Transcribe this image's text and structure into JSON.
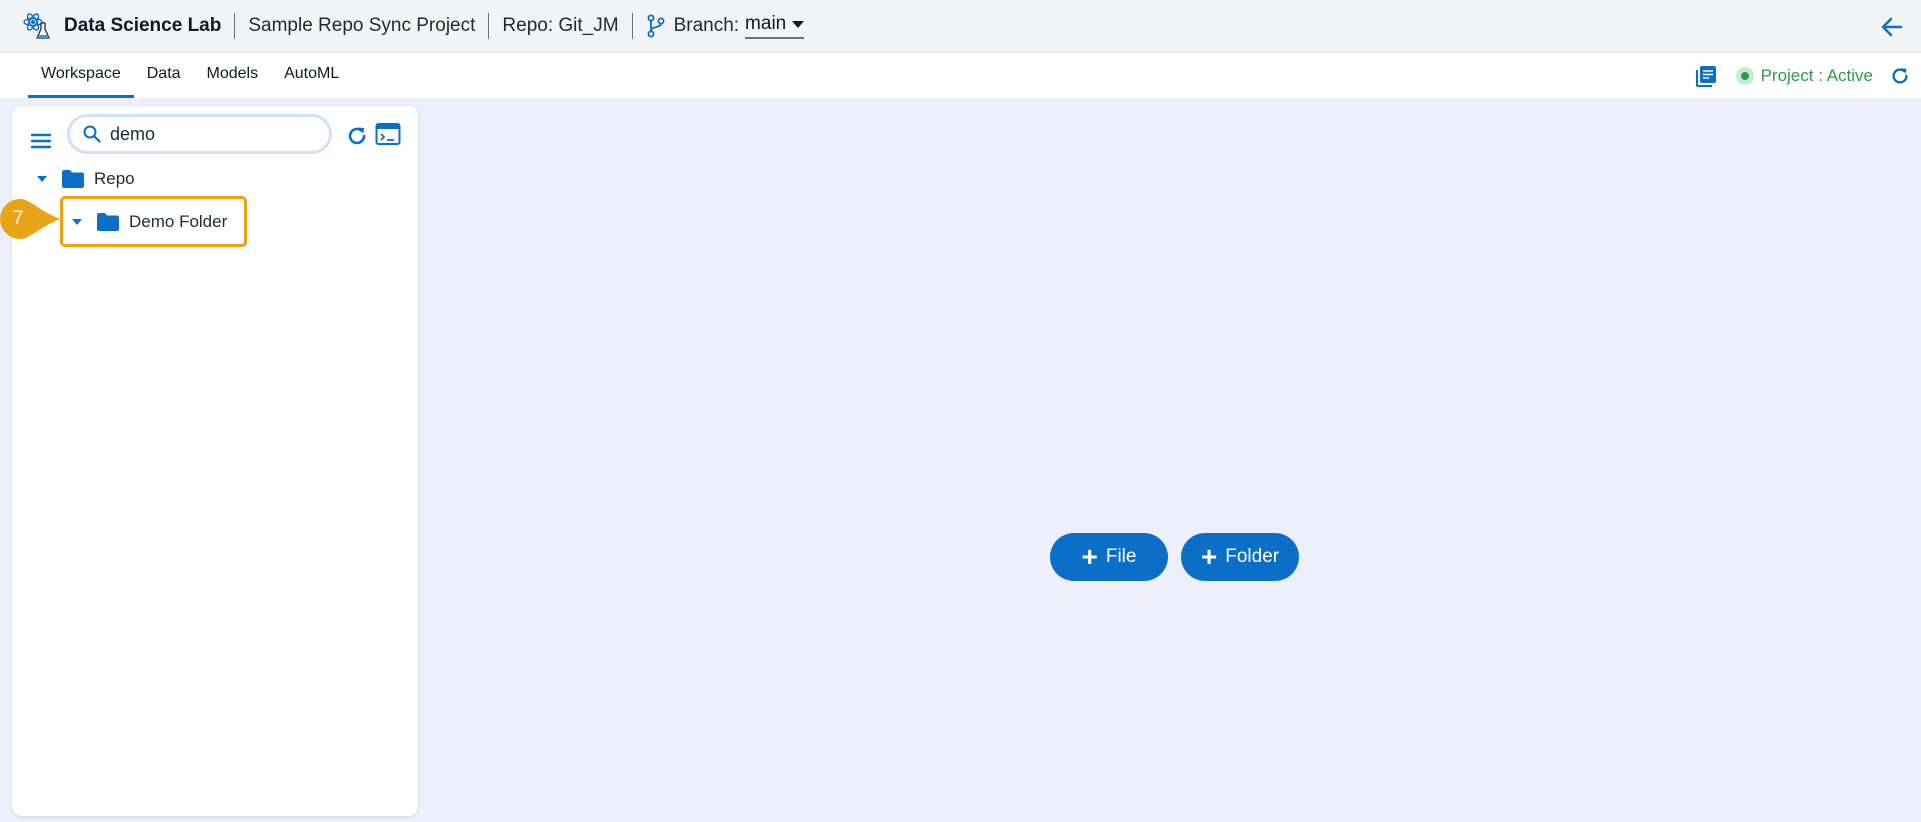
{
  "header": {
    "app_name": "Data Science Lab",
    "project_name": "Sample Repo Sync Project",
    "repo": "Repo: Git_JM",
    "branch_label": "Branch:",
    "branch_value": "main"
  },
  "tabs": [
    {
      "label": "Workspace",
      "active": true
    },
    {
      "label": "Data",
      "active": false
    },
    {
      "label": "Models",
      "active": false
    },
    {
      "label": "AutoML",
      "active": false
    }
  ],
  "status": {
    "text": "Project : Active",
    "color": "#2e9a4a"
  },
  "explorer": {
    "search_value": "demo",
    "tree": [
      {
        "label": "Repo",
        "expanded": true
      },
      {
        "label": "Demo Folder",
        "expanded": true
      }
    ]
  },
  "annotation": {
    "step": "7",
    "color": "#e8a317"
  },
  "actions": {
    "file_label": "File",
    "folder_label": "Folder"
  },
  "icons": {
    "app": "flask-atom-icon",
    "branch": "git-branch-icon",
    "back": "arrow-left-icon",
    "notes": "notes-icon",
    "refresh": "refresh-icon",
    "menu": "hamburger-menu-icon",
    "search": "search-icon",
    "terminal": "terminal-icon",
    "folder": "folder-icon"
  },
  "colors": {
    "accent": "#0b6fc7",
    "canvas": "#edf0fa",
    "highlight": "#e8a317"
  }
}
